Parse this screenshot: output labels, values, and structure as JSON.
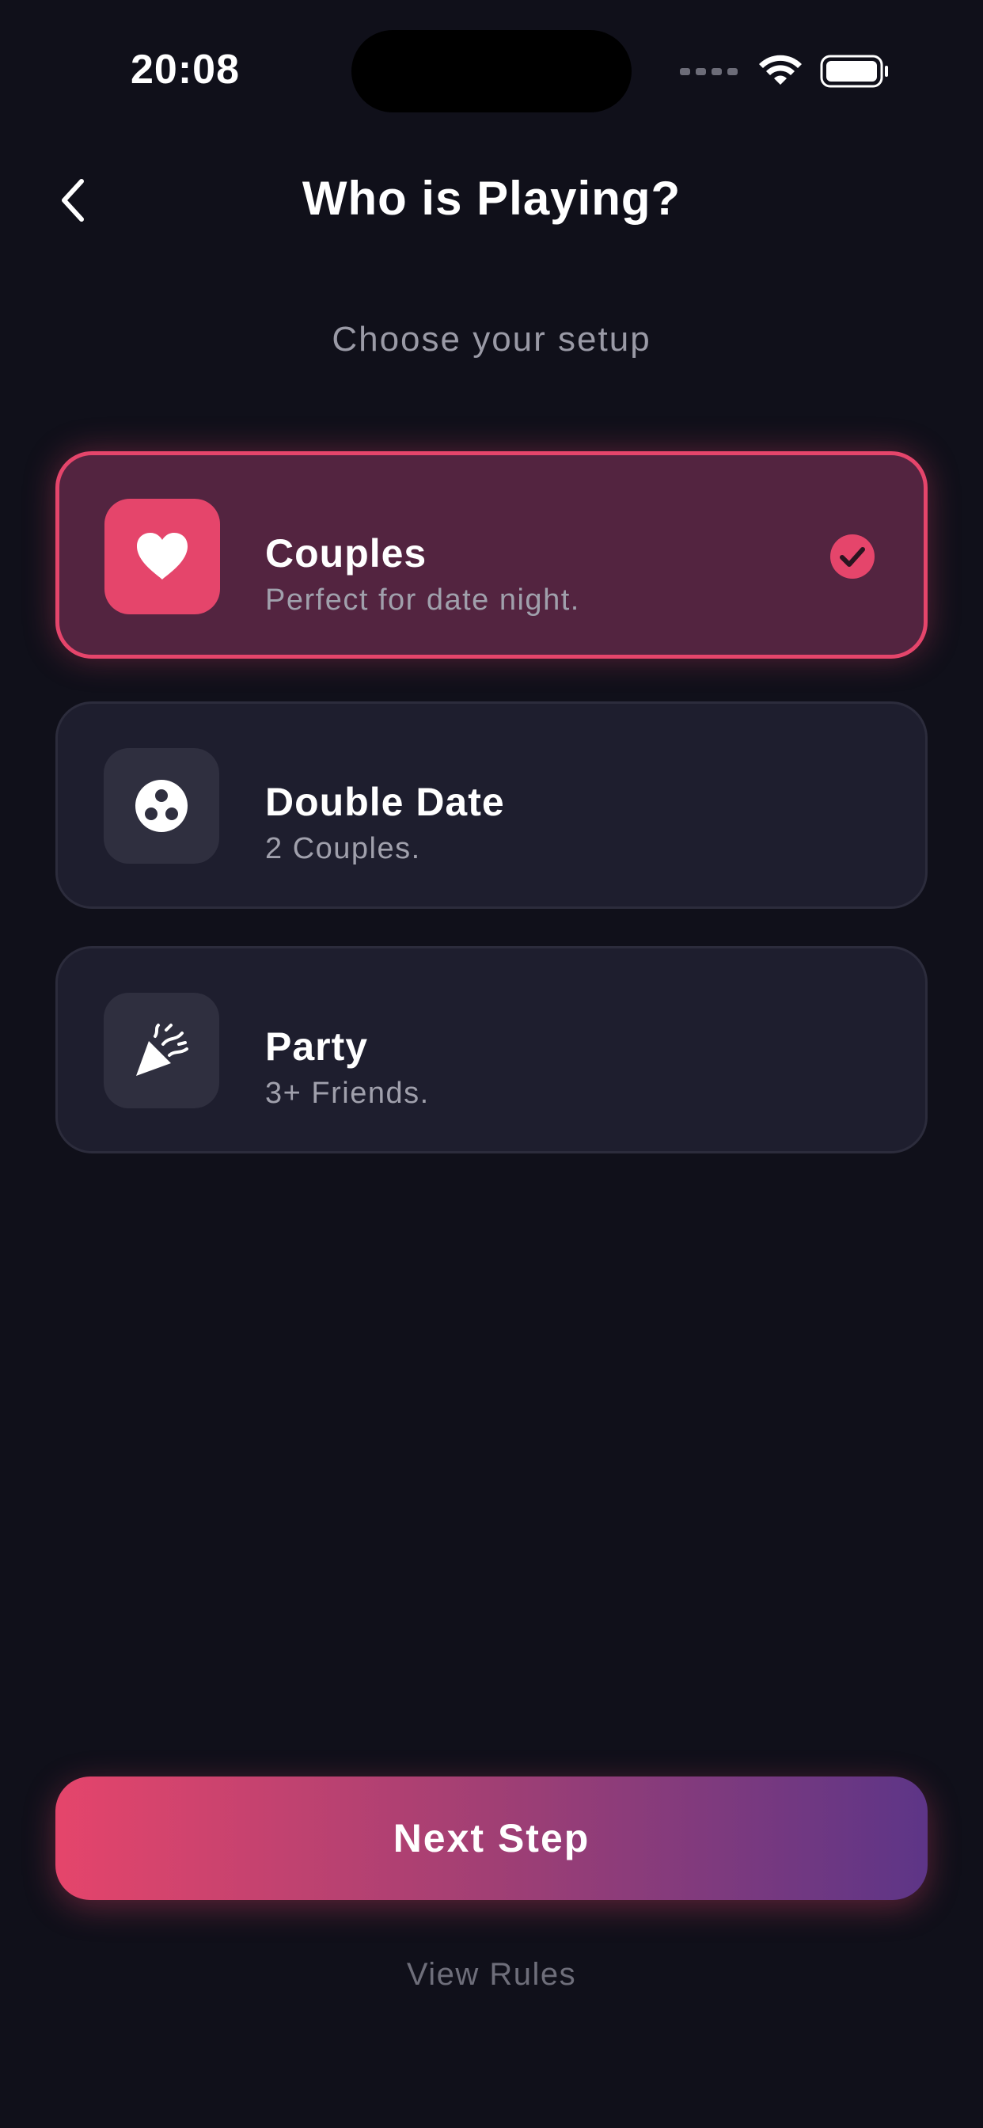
{
  "status_bar": {
    "time": "20:08"
  },
  "header": {
    "title": "Who is Playing?",
    "subtitle": "Choose your setup"
  },
  "options": [
    {
      "title": "Couples",
      "description": "Perfect for date night.",
      "icon": "heart-icon",
      "selected": true
    },
    {
      "title": "Double Date",
      "description": "2 Couples.",
      "icon": "dice-icon",
      "selected": false
    },
    {
      "title": "Party",
      "description": "3+ Friends.",
      "icon": "party-popper-icon",
      "selected": false
    }
  ],
  "actions": {
    "next_label": "Next Step",
    "rules_label": "View Rules"
  },
  "colors": {
    "background": "#10101a",
    "accent": "#e5456b",
    "card": "#1e1e2e",
    "selected_card": "#532440",
    "gradient_end": "#5d3587"
  }
}
